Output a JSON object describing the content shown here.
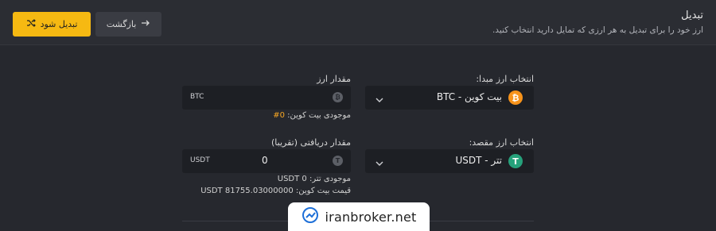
{
  "header": {
    "title": "تبدیل",
    "subtitle": "ارز خود را برای تبدیل به هر ارزی که تمایل دارید انتخاب کنید.",
    "convert_label": "تبدیل شود",
    "back_label": "بازگشت"
  },
  "source": {
    "label": "انتخاب ارز مبدا:",
    "value": "بیت کوین - BTC",
    "icon": "bitcoin-icon"
  },
  "destination": {
    "label": "انتخاب ارز مقصد:",
    "value": "تتر - USDT",
    "icon": "tether-icon"
  },
  "amount": {
    "label": "مقدار ارز",
    "unit": "BTC",
    "value": "",
    "balance_label": "موجودی بیت کوین:",
    "balance_value": "0#"
  },
  "received": {
    "label": "مقدار دریافتی (تقریبا)",
    "unit": "USDT",
    "value": "0",
    "tether_balance": "موجودی تتر: 0 USDT",
    "btc_price_label": "قیمت بیت کوین:",
    "btc_price_value": "USDT 81755.03000000"
  },
  "watermark": {
    "text": "iranbroker.net"
  },
  "colors": {
    "accent": "#f6b912",
    "bitcoin": "#f7931a",
    "tether": "#26a17b"
  }
}
